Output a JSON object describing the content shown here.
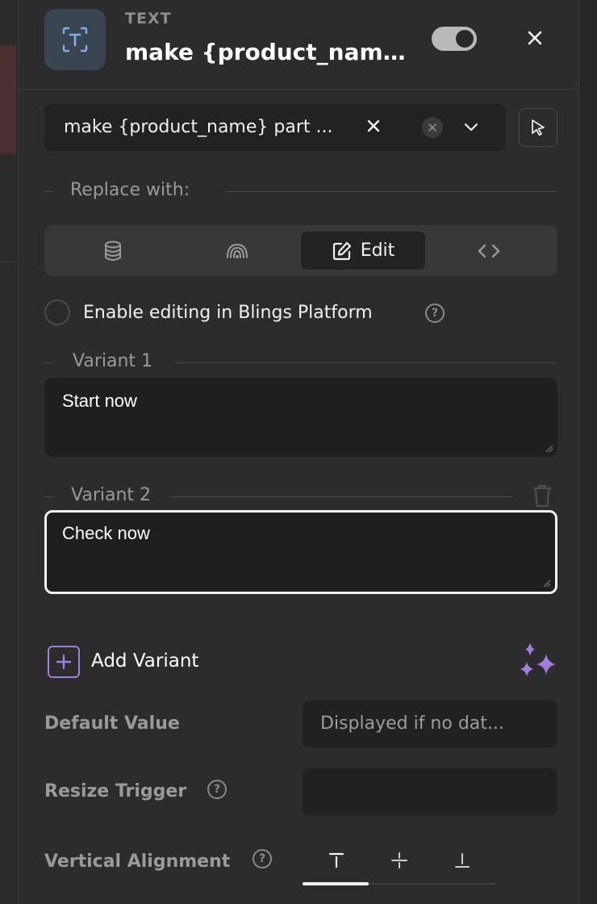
{
  "header": {
    "type_label": "TEXT",
    "title": "make {product_name}...",
    "toggle_on": true
  },
  "layer_select": {
    "value": "make {product_name} part ..."
  },
  "replace_with": {
    "label": "Replace with:",
    "options": [
      {
        "icon": "database-icon",
        "label": ""
      },
      {
        "icon": "broadcast-icon",
        "label": ""
      },
      {
        "icon": "edit-icon",
        "label": "Edit",
        "active": true
      },
      {
        "icon": "code-icon",
        "label": ""
      }
    ]
  },
  "enable_editing": {
    "label": "Enable editing in Blings Platform",
    "checked": false
  },
  "variants": [
    {
      "label": "Variant 1",
      "value": "Start now"
    },
    {
      "label": "Variant 2",
      "value": "Check now",
      "focused": true
    }
  ],
  "add_variant": {
    "label": "Add Variant"
  },
  "properties": {
    "default_value": {
      "label": "Default Value",
      "placeholder": "Displayed if no dat..."
    },
    "resize_trigger": {
      "label": "Resize Trigger",
      "value": ""
    },
    "vertical_alignment": {
      "label": "Vertical Alignment",
      "options": [
        "top-align-icon",
        "middle-align-icon",
        "bottom-align-icon"
      ],
      "selected": "top-align-icon"
    }
  },
  "colors": {
    "background": "#2c2c2c",
    "input_bg": "#1f1f1f",
    "accent_purple": "#a17de0",
    "header_icon_bg": "#3a4552"
  }
}
